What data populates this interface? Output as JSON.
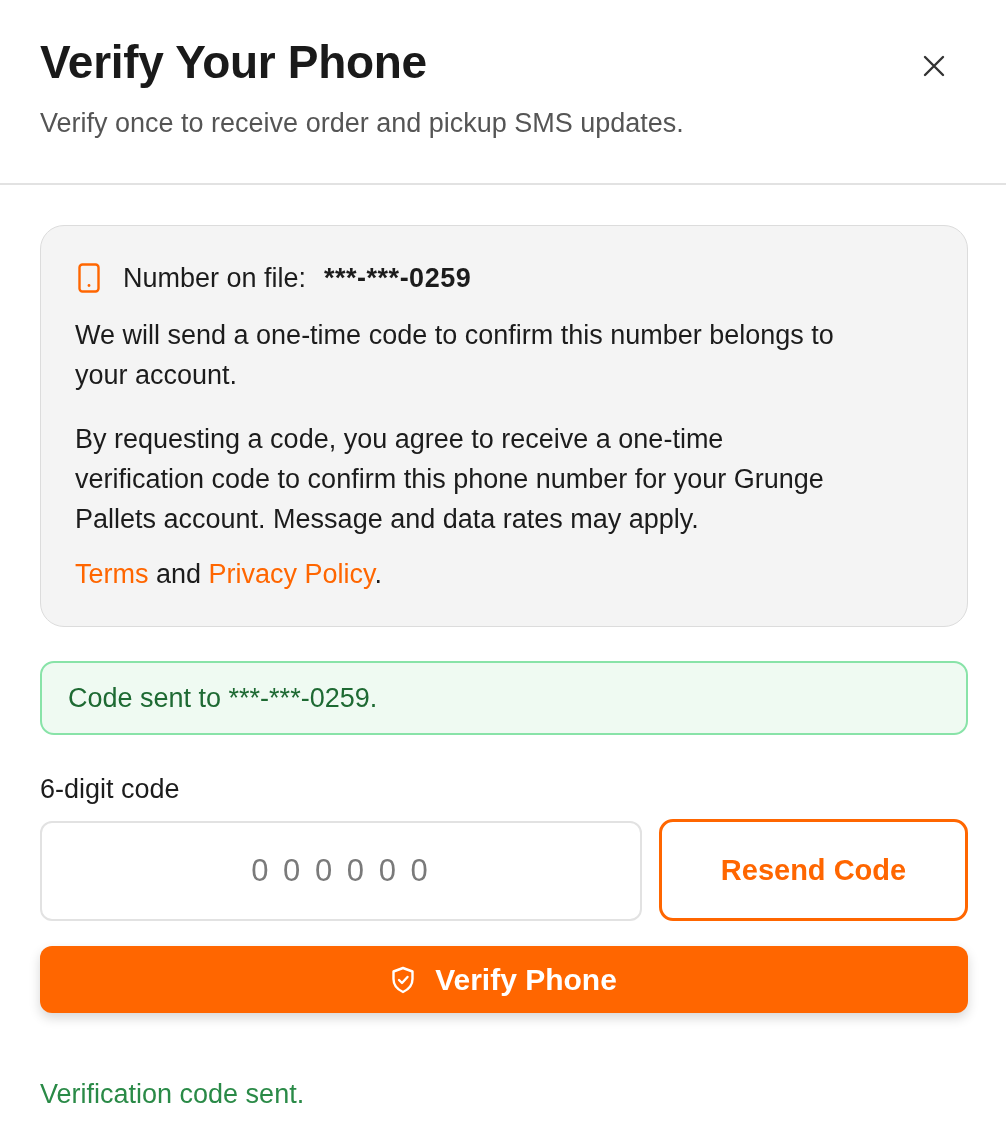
{
  "dialog": {
    "title": "Verify Your Phone",
    "subtitle": "Verify once to receive order and pickup SMS updates."
  },
  "info_card": {
    "number_label": "Number on file:",
    "number_value": "***-***-0259",
    "notice": "We will send a one-time code to confirm this number belongs to your account.",
    "consent": "By requesting a code, you agree to receive a one-time verification code to confirm this phone number for your Grunge Pallets account. Message and data rates may apply.",
    "legal_line": [
      {
        "kind": "link",
        "text": "Terms"
      },
      {
        "kind": "text",
        "text": " and "
      },
      {
        "kind": "link",
        "text": "Privacy Policy"
      },
      {
        "kind": "text",
        "text": "."
      }
    ]
  },
  "alert": {
    "kind": "success",
    "message": "Code sent to ***-***-0259."
  },
  "code_field": {
    "label": "6-digit code",
    "placeholder": "0 0 0 0 0 0"
  },
  "buttons": {
    "resend": "Resend Code",
    "verify": "Verify Phone"
  },
  "status": {
    "kind": "success",
    "message": "Verification code sent."
  }
}
